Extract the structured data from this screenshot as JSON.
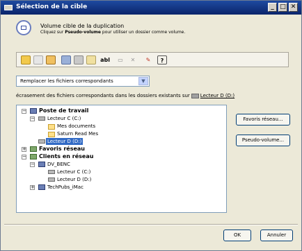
{
  "window": {
    "title": "Sélection de la cible"
  },
  "header": {
    "title": "Volume cible de la duplication",
    "subtitle_prefix": "Cliquez sur ",
    "subtitle_bold": "Pseudo-volume",
    "subtitle_suffix": " pour utiliser un dossier comme volume."
  },
  "toolbar": {
    "text_tool_label": "abl"
  },
  "replace_select": {
    "value": "Remplacer les fichiers correspondants"
  },
  "description": {
    "text": "écrasement des fichiers correspondants dans les dossiers existants sur",
    "target": "Lecteur D (D:)"
  },
  "tree": {
    "items": [
      {
        "label": "Poste de travail"
      },
      {
        "label": "Lecteur C (C:)"
      },
      {
        "label": "Mes documents"
      },
      {
        "label": "Saturn Read Mes"
      },
      {
        "label": "Lecteur D (D:)"
      },
      {
        "label": "Favoris réseau"
      },
      {
        "label": "Clients en réseau"
      },
      {
        "label": "DV_BENC"
      },
      {
        "label": "Lecteur C (C:)"
      },
      {
        "label": "Lecteur D (D:)"
      },
      {
        "label": "TechPubs_iMac"
      }
    ]
  },
  "buttons": {
    "favoris": "Favoris réseau...",
    "pseudo": "Pseudo-volume...",
    "ok": "OK",
    "cancel": "Annuler"
  },
  "colors": {
    "title_bar": "#0a246a",
    "selection": "#316ac5",
    "dialog_bg": "#ece9d8"
  }
}
